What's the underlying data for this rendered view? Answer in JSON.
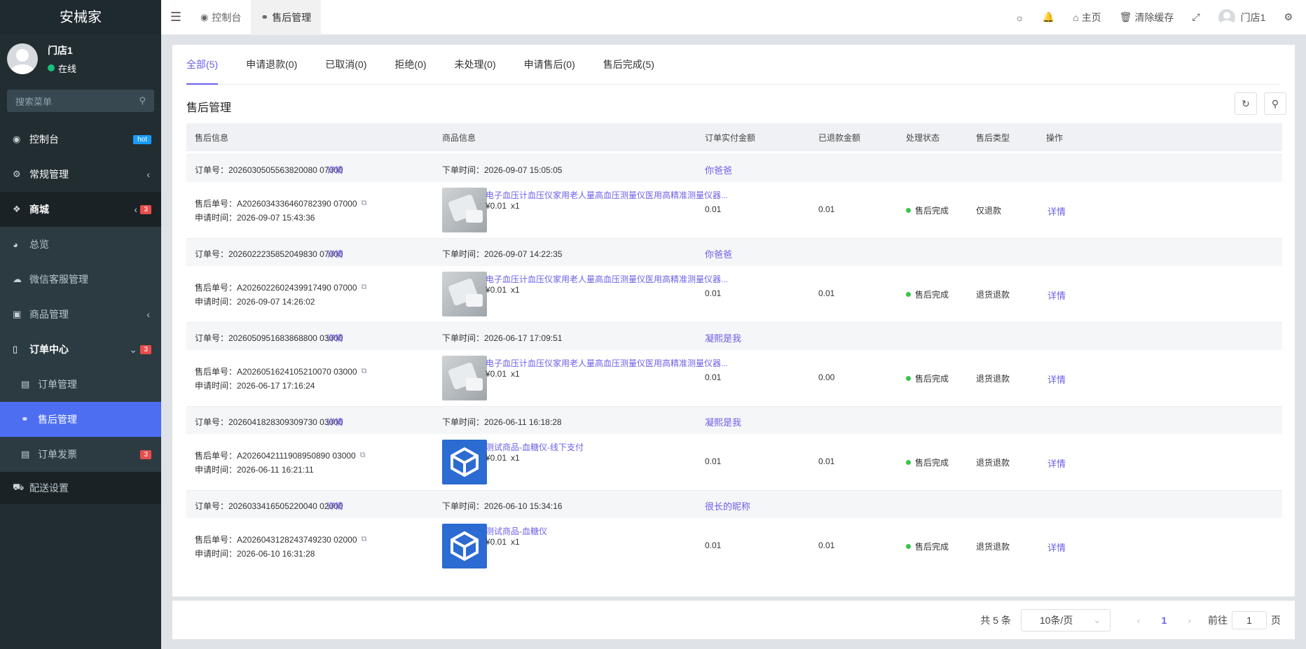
{
  "sidebar": {
    "brand": "安械家",
    "user": {
      "name": "门店1",
      "status": "在线"
    },
    "search_placeholder": "搜索菜单",
    "items": [
      {
        "label": "控制台",
        "badge": "hot"
      },
      {
        "label": "常规管理"
      },
      {
        "label": "商城",
        "badge": "3"
      },
      {
        "label": "总览"
      },
      {
        "label": "微信客服管理"
      },
      {
        "label": "商品管理"
      },
      {
        "label": "订单中心",
        "badge": "3"
      },
      {
        "label": "订单管理"
      },
      {
        "label": "售后管理"
      },
      {
        "label": "订单发票",
        "badge": "3"
      },
      {
        "label": "配送设置"
      }
    ]
  },
  "topbar": {
    "tabs": [
      {
        "label": "控制台"
      },
      {
        "label": "售后管理"
      }
    ],
    "home": "主页",
    "clear_cache": "清除缓存",
    "user": "门店1"
  },
  "main": {
    "tabs": [
      "全部(5)",
      "申请退款(0)",
      "已取消(0)",
      "拒绝(0)",
      "未处理(0)",
      "申请售后(0)",
      "售后完成(5)"
    ],
    "title": "售后管理",
    "columns": [
      "售后信息",
      "商品信息",
      "订单实付金额",
      "已退款金额",
      "处理状态",
      "售后类型",
      "操作"
    ],
    "rows": [
      {
        "order_no": "订单号：2026030505563820080 07000",
        "order_time": "下单时间：2026-09-07 15:05:05",
        "nickname": "你爸爸",
        "aftersale_no": "售后单号：A2026034336460782390 07000",
        "apply_time": "申请时间：2026-09-07 15:43:36",
        "product": "电子血压计血压仪家用老人量高血压测量仪医用高精准测量仪器...",
        "price": "¥0.01",
        "qty": "x1",
        "paid": "0.01",
        "refunded": "0.01",
        "status": "售后完成",
        "type": "仅退款",
        "action": "详情"
      },
      {
        "order_no": "订单号：2026022235852049830 07000",
        "order_time": "下单时间：2026-09-07 14:22:35",
        "nickname": "你爸爸",
        "aftersale_no": "售后单号：A2026022602439917490 07000",
        "apply_time": "申请时间：2026-09-07 14:26:02",
        "product": "电子血压计血压仪家用老人量高血压测量仪医用高精准测量仪器...",
        "price": "¥0.01",
        "qty": "x1",
        "paid": "0.01",
        "refunded": "0.01",
        "status": "售后完成",
        "type": "退货退款",
        "action": "详情"
      },
      {
        "order_no": "订单号：2026050951683868800 03000",
        "order_time": "下单时间：2026-06-17 17:09:51",
        "nickname": "凝熙是我",
        "aftersale_no": "售后单号：A2026051624105210070 03000",
        "apply_time": "申请时间：2026-06-17 17:16:24",
        "product": "电子血压计血压仪家用老人量高血压测量仪医用高精准测量仪器...",
        "price": "¥0.01",
        "qty": "x1",
        "paid": "0.01",
        "refunded": "0.00",
        "status": "售后完成",
        "type": "退货退款",
        "action": "详情"
      },
      {
        "order_no": "订单号：2026041828309309730 03000",
        "order_time": "下单时间：2026-06-11 16:18:28",
        "nickname": "凝熙是我",
        "aftersale_no": "售后单号：A2026042111908950890 03000",
        "apply_time": "申请时间：2026-06-11 16:21:11",
        "product": "测试商品-血糖仪-线下支付",
        "price": "¥0.01",
        "qty": "x1",
        "paid": "0.01",
        "refunded": "0.01",
        "status": "售后完成",
        "type": "退货退款",
        "action": "详情"
      },
      {
        "order_no": "订单号：2026033416505220040 02000",
        "order_time": "下单时间：2026-06-10 15:34:16",
        "nickname": "很长的昵称",
        "aftersale_no": "售后单号：A2026043128243749230 02000",
        "apply_time": "申请时间：2026-06-10 16:31:28",
        "product": "测试商品-血糖仪",
        "price": "¥0.01",
        "qty": "x1",
        "paid": "0.01",
        "refunded": "0.01",
        "status": "售后完成",
        "type": "退货退款",
        "action": "详情"
      }
    ],
    "detail_link": "详情"
  },
  "pagination": {
    "total": "共 5 条",
    "page_size": "10条/页",
    "current": "1",
    "goto_label": "前往",
    "goto_value": "1",
    "page_suffix": "页"
  },
  "colors": {
    "accent": "#6b5fe8",
    "sidebar_bg": "#222d32",
    "active_menu": "#4e6ef2",
    "success": "#36c54b"
  }
}
